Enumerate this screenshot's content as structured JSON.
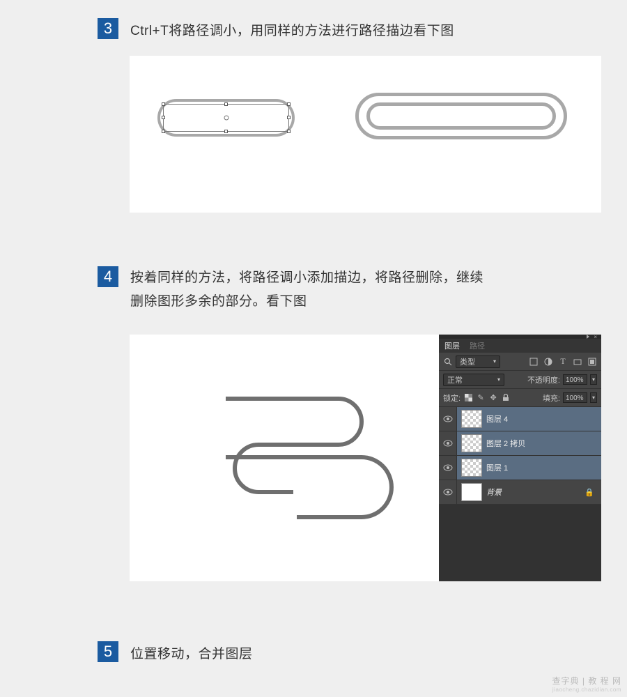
{
  "step3": {
    "badge": "3",
    "text": "Ctrl+T将路径调小，用同样的方法进行路径描边看下图"
  },
  "step4": {
    "badge": "4",
    "text_line1": "按着同样的方法，将路径调小添加描边，将路径删除，继续",
    "text_line2": "删除图形多余的部分。看下图"
  },
  "step5": {
    "badge": "5",
    "text": "位置移动，合并图层"
  },
  "layers_panel": {
    "tab_layers": "图层",
    "tab_paths": "路径",
    "filter_label": "类型",
    "blend_mode": "正常",
    "opacity_label": "不透明度:",
    "opacity_value": "100%",
    "lock_label": "锁定:",
    "fill_label": "填充:",
    "fill_value": "100%",
    "layers": [
      {
        "name": "图层 4"
      },
      {
        "name": "图层 2 拷贝"
      },
      {
        "name": "图层 1"
      },
      {
        "name": "背景",
        "locked": true,
        "bg": true
      }
    ]
  },
  "watermark": {
    "title": "查字典 | 教 程 网",
    "sub": "jiaocheng.chazidian.com"
  }
}
